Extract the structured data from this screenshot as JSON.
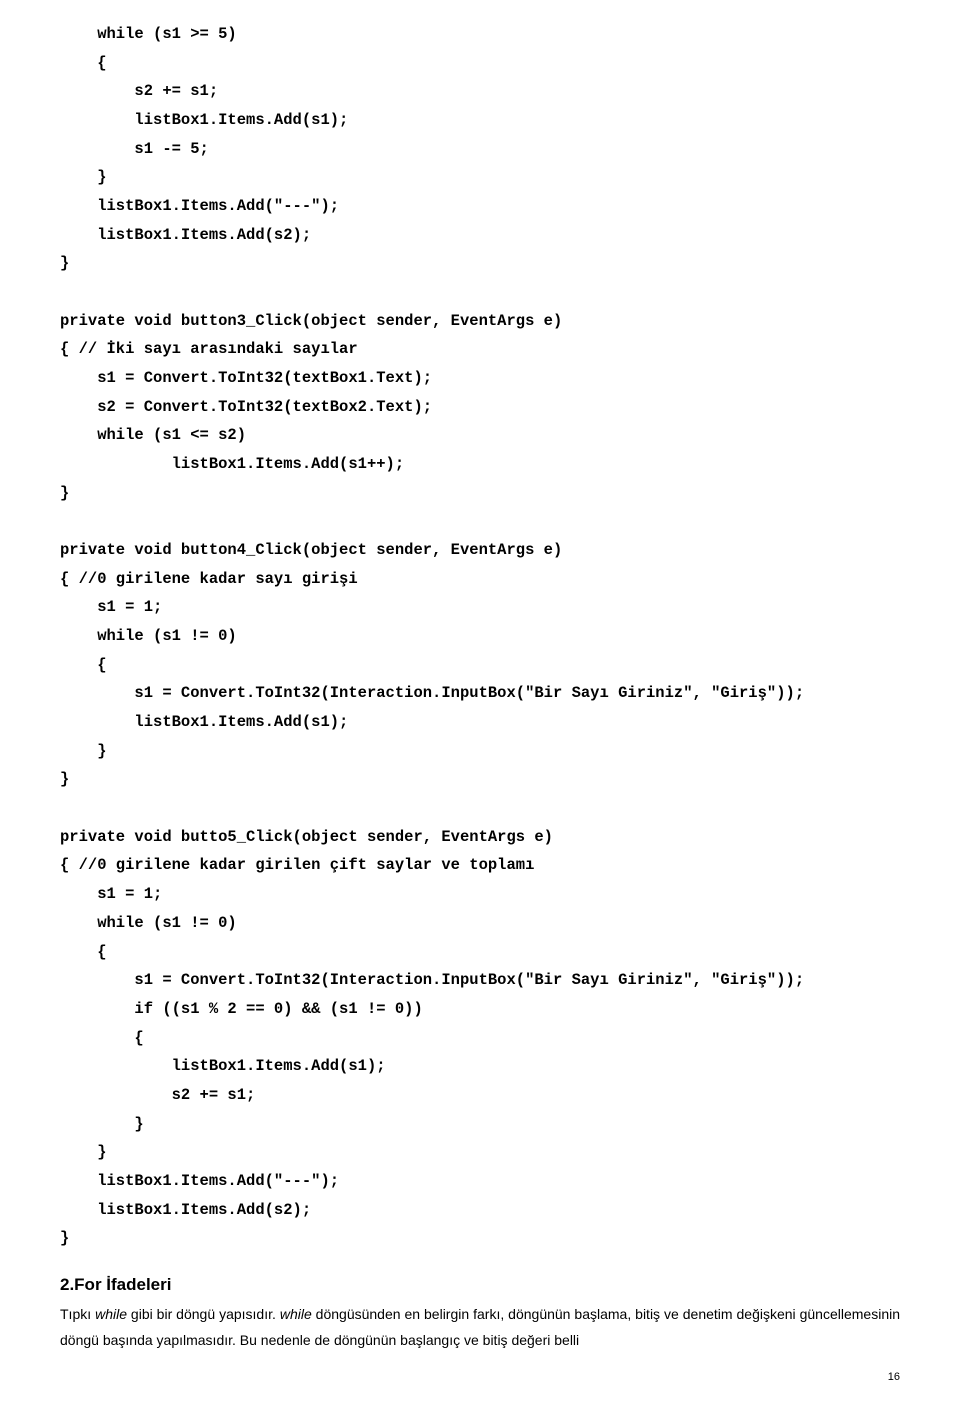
{
  "code_block_1": "    while (s1 >= 5)\n    {\n        s2 += s1;\n        listBox1.Items.Add(s1);\n        s1 -= 5;\n    }\n    listBox1.Items.Add(\"---\");\n    listBox1.Items.Add(s2);\n}\n\nprivate void button3_Click(object sender, EventArgs e)\n{ // İki sayı arasındaki sayılar\n    s1 = Convert.ToInt32(textBox1.Text);\n    s2 = Convert.ToInt32(textBox2.Text);\n    while (s1 <= s2)\n            listBox1.Items.Add(s1++);\n}\n\nprivate void button4_Click(object sender, EventArgs e)\n{ //0 girilene kadar sayı girişi\n    s1 = 1;\n    while (s1 != 0)\n    {\n        s1 = Convert.ToInt32(Interaction.InputBox(\"Bir Sayı Giriniz\", \"Giriş\"));\n        listBox1.Items.Add(s1);\n    }\n}\n\nprivate void butto5_Click(object sender, EventArgs e)\n{ //0 girilene kadar girilen çift saylar ve toplamı\n    s1 = 1;\n    while (s1 != 0)\n    {\n        s1 = Convert.ToInt32(Interaction.InputBox(\"Bir Sayı Giriniz\", \"Giriş\"));\n        if ((s1 % 2 == 0) && (s1 != 0))\n        {\n            listBox1.Items.Add(s1);\n            s2 += s1;\n        }\n    }\n    listBox1.Items.Add(\"---\");\n    listBox1.Items.Add(s2);\n}",
  "heading": "2.For İfadeleri",
  "para_prefix": "Tıpkı ",
  "para_italic1": "while",
  "para_mid1": " gibi bir döngü yapısıdır. ",
  "para_italic2": "while",
  "para_mid2": " döngüsünden en belirgin farkı, döngünün başlama, bitiş ve denetim değişkeni güncellemesinin döngü başında yapılmasıdır. Bu nedenle de döngünün başlangıç ve bitiş değeri belli",
  "page_number": "16"
}
